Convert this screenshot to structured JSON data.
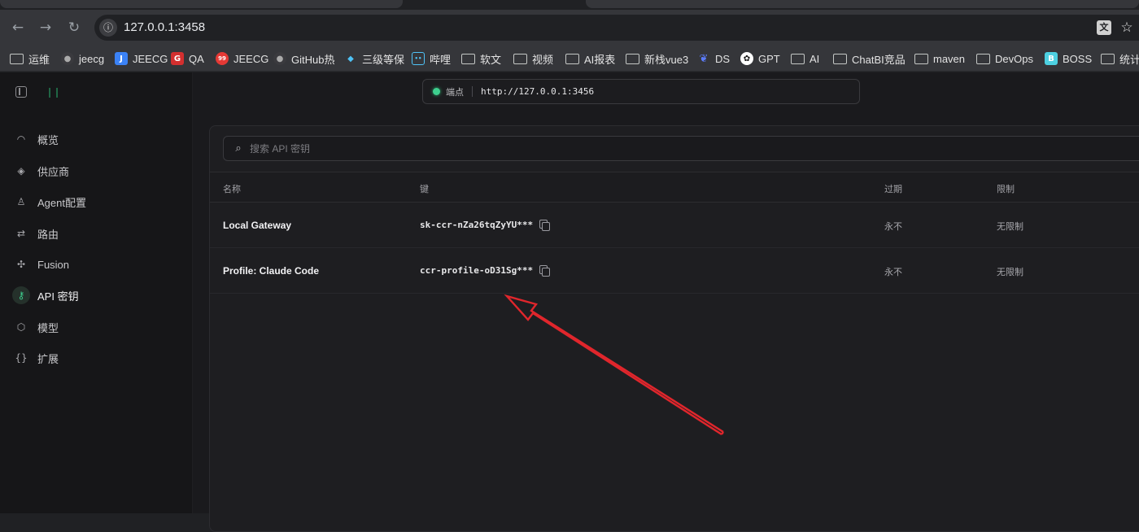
{
  "browser": {
    "url": "127.0.0.1:3458",
    "back_icon": "arrow-left-icon",
    "forward_icon": "arrow-right-icon",
    "reload_icon": "reload-icon",
    "translate_icon": "translate-icon",
    "star_icon": "star-icon",
    "bookmarks": [
      {
        "label": "运维",
        "icon": "folder-icon"
      },
      {
        "label": "jeecg",
        "icon": "github-icon"
      },
      {
        "label": "JEECG",
        "icon": "site-icon"
      },
      {
        "label": "QA",
        "icon": "site-icon"
      },
      {
        "label": "JEECG",
        "icon": "site-icon"
      },
      {
        "label": "GitHub热",
        "icon": "github-icon"
      },
      {
        "label": "三级等保",
        "icon": "site-icon"
      },
      {
        "label": "哔哩",
        "icon": "bilibili-icon"
      },
      {
        "label": "软文",
        "icon": "folder-icon"
      },
      {
        "label": "视频",
        "icon": "folder-icon"
      },
      {
        "label": "AI报表",
        "icon": "folder-icon"
      },
      {
        "label": "新栈vue3",
        "icon": "folder-icon"
      },
      {
        "label": "DS",
        "icon": "deepseek-icon"
      },
      {
        "label": "GPT",
        "icon": "openai-icon"
      },
      {
        "label": "AI",
        "icon": "folder-icon"
      },
      {
        "label": "ChatBI竞品",
        "icon": "folder-icon"
      },
      {
        "label": "maven",
        "icon": "folder-icon"
      },
      {
        "label": "DevOps",
        "icon": "folder-icon"
      },
      {
        "label": "BOSS",
        "icon": "site-icon"
      },
      {
        "label": "统计",
        "icon": "folder-icon"
      }
    ]
  },
  "sidebar": {
    "items": [
      {
        "label": "概览",
        "icon": "gauge-icon"
      },
      {
        "label": "供应商",
        "icon": "layers-icon"
      },
      {
        "label": "Agent配置",
        "icon": "user-icon"
      },
      {
        "label": "路由",
        "icon": "route-icon"
      },
      {
        "label": "Fusion",
        "icon": "fusion-icon"
      },
      {
        "label": "API 密钥",
        "icon": "key-icon",
        "active": true
      },
      {
        "label": "模型",
        "icon": "cube-icon"
      },
      {
        "label": "扩展",
        "icon": "braces-icon"
      }
    ]
  },
  "endpoint": {
    "label": "端点",
    "url": "http://127.0.0.1:3456"
  },
  "search": {
    "placeholder": "搜索 API 密钥",
    "value": ""
  },
  "table": {
    "headers": {
      "name": "名称",
      "key": "键",
      "expiry": "过期",
      "limit": "限制"
    },
    "rows": [
      {
        "name": "Local Gateway",
        "key": "sk-ccr-nZa26tqZyYU***",
        "expiry": "永不",
        "limit": "无限制"
      },
      {
        "name": "Profile: Claude Code",
        "key": "ccr-profile-oD31Sg***",
        "expiry": "永不",
        "limit": "无限制"
      }
    ]
  },
  "colors": {
    "accent": "#3ecf8e",
    "annotation_arrow": "#e0262c"
  }
}
